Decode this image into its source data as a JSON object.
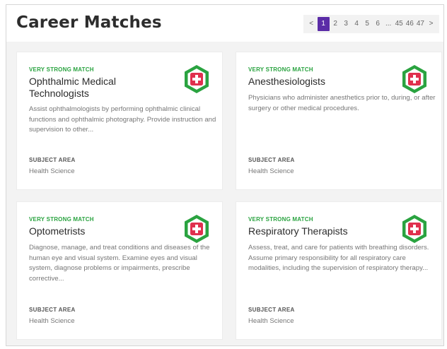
{
  "header": {
    "title": "Career Matches"
  },
  "pagination": {
    "prev_label": "<",
    "next_label": ">",
    "pages": [
      "1",
      "2",
      "3",
      "4",
      "5",
      "6",
      "...",
      "45",
      "46",
      "47"
    ],
    "current": "1"
  },
  "theme": {
    "accent": "#5b2ca7",
    "match_color": "#2aa340",
    "badge_green": "#2aa340",
    "badge_red": "#e0304e"
  },
  "cards": [
    {
      "match": "VERY STRONG MATCH",
      "title": "Ophthalmic Medical Technologists",
      "description": "Assist ophthalmologists by performing ophthalmic clinical functions and ophthalmic photography. Provide instruction and supervision to other...",
      "subject_label": "SUBJECT AREA",
      "subject_value": "Health Science",
      "icon": "health-cross-icon"
    },
    {
      "match": "VERY STRONG MATCH",
      "title": "Anesthesiologists",
      "description": "Physicians who administer anesthetics prior to, during, or after surgery or other medical procedures.",
      "subject_label": "SUBJECT AREA",
      "subject_value": "Health Science",
      "icon": "health-cross-icon"
    },
    {
      "match": "VERY STRONG MATCH",
      "title": "Optometrists",
      "description": "Diagnose, manage, and treat conditions and diseases of the human eye and visual system. Examine eyes and visual system, diagnose problems or impairments, prescribe corrective...",
      "subject_label": "SUBJECT AREA",
      "subject_value": "Health Science",
      "icon": "health-cross-icon"
    },
    {
      "match": "VERY STRONG MATCH",
      "title": "Respiratory Therapists",
      "description": "Assess, treat, and care for patients with breathing disorders. Assume primary responsibility for all respiratory care modalities, including the supervision of respiratory therapy...",
      "subject_label": "SUBJECT AREA",
      "subject_value": "Health Science",
      "icon": "health-cross-icon"
    }
  ]
}
